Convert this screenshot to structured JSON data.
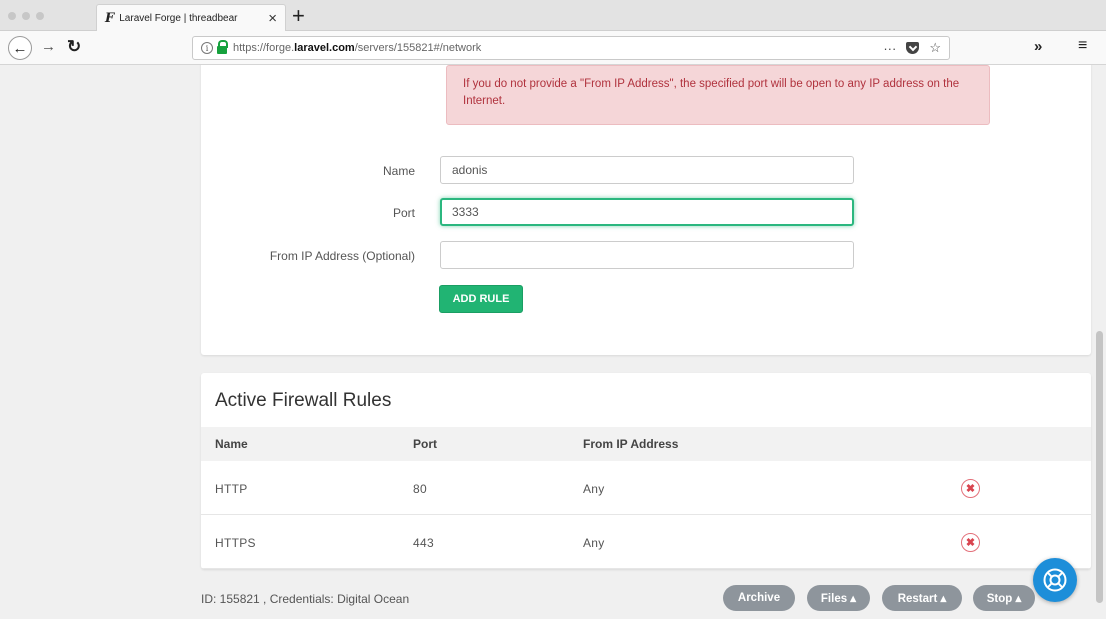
{
  "browser": {
    "tab": {
      "favicon": "F",
      "title": "Laravel Forge | threadbear"
    },
    "url": {
      "prefix": "https://forge.",
      "domain": "laravel.com",
      "path": "/servers/155821#/network"
    },
    "url_more": "···",
    "star": "☆",
    "overflow": "»",
    "menu": "≡"
  },
  "form": {
    "warning": "If you do not provide a \"From IP Address\", the specified port will be open to any IP address on the Internet.",
    "name_label": "Name",
    "name_value": "adonis",
    "port_label": "Port",
    "port_value": "3333",
    "ip_label": "From IP Address (Optional)",
    "ip_value": "",
    "add_button": "ADD RULE"
  },
  "rules": {
    "title": "Active Firewall Rules",
    "columns": [
      "Name",
      "Port",
      "From IP Address"
    ],
    "rows": [
      {
        "name": "HTTP",
        "port": "80",
        "from": "Any"
      },
      {
        "name": "HTTPS",
        "port": "443",
        "from": "Any"
      }
    ]
  },
  "footer": {
    "info": "ID: 155821 , Credentials: Digital Ocean",
    "buttons": [
      "Archive",
      "Files ▴",
      "Restart ▴",
      "Stop ▴"
    ]
  },
  "colors": {
    "accent_green": "#21b473",
    "alert_bg": "#f5d6d8",
    "alert_text": "#b0323d",
    "pill_gray": "#8e959c",
    "help_blue": "#1d8ed9",
    "delete_red": "#d9444f"
  },
  "icons": {
    "back": "back-arrow-icon",
    "forward": "forward-arrow-icon",
    "reload": "reload-icon",
    "delete": "close-circle-icon",
    "help": "lifebuoy-icon"
  }
}
